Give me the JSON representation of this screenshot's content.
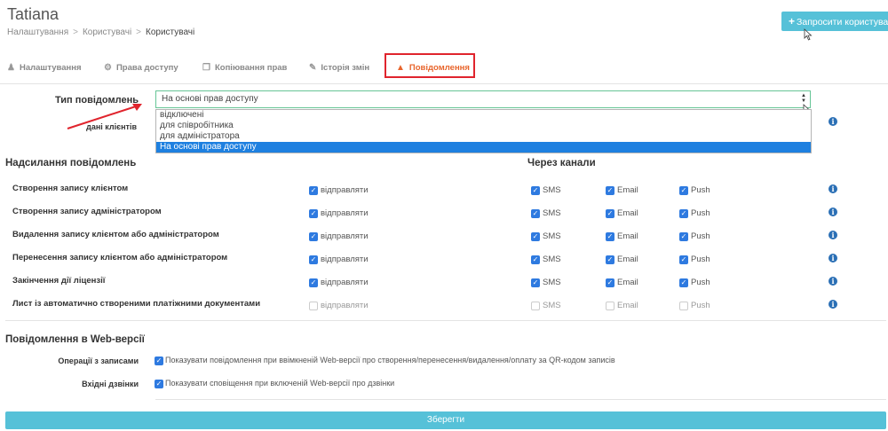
{
  "header": {
    "title": "Tatiana",
    "breadcrumbs": [
      "Налаштування",
      "Користувачі",
      "Користувачі"
    ],
    "invite_button": "Запросити користувачів"
  },
  "tabs": [
    {
      "label": "Налаштування",
      "icon": "user-icon"
    },
    {
      "label": "Права доступу",
      "icon": "gears-icon"
    },
    {
      "label": "Копіювання прав",
      "icon": "copy-icon"
    },
    {
      "label": "Історія змін",
      "icon": "edit-icon"
    },
    {
      "label": "Повідомлення",
      "icon": "bell-icon",
      "active": true
    }
  ],
  "notification_type": {
    "label": "Тип повідомлень",
    "value": "На основі прав доступу",
    "options": [
      "відключені",
      "для співробітника",
      "для адміністратора",
      "На основі прав доступу"
    ],
    "selected_index": 3
  },
  "client_data": {
    "label": "дані клієнтів"
  },
  "sending": {
    "title": "Надсилання повідомлень",
    "channels_title": "Через канали",
    "send_label": "відправляти",
    "channel_labels": [
      "SMS",
      "Email",
      "Push"
    ],
    "rows": [
      {
        "label": "Створення запису клієнтом",
        "send": true,
        "sms": true,
        "email": true,
        "push": true
      },
      {
        "label": "Створення запису адміністратором",
        "send": true,
        "sms": true,
        "email": true,
        "push": true
      },
      {
        "label": "Видалення запису клієнтом або адміністратором",
        "send": true,
        "sms": true,
        "email": true,
        "push": true
      },
      {
        "label": "Перенесення запису клієнтом або адміністратором",
        "send": true,
        "sms": true,
        "email": true,
        "push": true
      },
      {
        "label": "Закінчення дії ліцензії",
        "send": true,
        "sms": true,
        "email": true,
        "push": true
      },
      {
        "label": "Лист із автоматично створеними платіжними документами",
        "send": false,
        "sms": false,
        "email": false,
        "push": false
      }
    ]
  },
  "web": {
    "title": "Повідомлення в Web-версії",
    "items": [
      {
        "label": "Операції з записами",
        "text": "Показувати повідомлення при ввімкненій Web-версії про створення/перенесення/видалення/оплату за QR-кодом записів",
        "checked": true
      },
      {
        "label": "Вхідні дзвінки",
        "text": "Показувати сповіщення при включеній Web-версії про дзвінки",
        "checked": true
      }
    ]
  },
  "save_button": "Зберегти",
  "colors": {
    "accent": "#56c1d8",
    "active_tab": "#e8652c",
    "checkbox": "#2e7ae0",
    "highlight": "#e0242d",
    "info": "#2a6fb5"
  }
}
